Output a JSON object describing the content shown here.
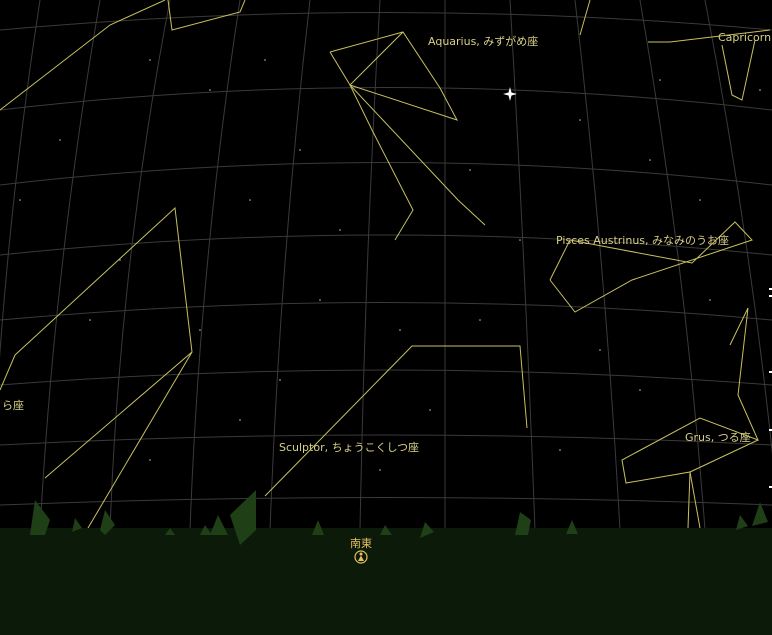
{
  "constellations": {
    "aquarius": "Aquarius, みずがめ座",
    "capricornus": "Capricorn",
    "piscis_austrinus": "Pisces Austrinus, みなみのうお座",
    "sculptor": "Sculptor, ちょうこくしつ座",
    "grus": "Grus, つる座",
    "left_partial": "ら座"
  },
  "horizon": {
    "direction_label": "南東"
  },
  "colors": {
    "sky": "#000000",
    "grid": "#3a3a3a",
    "constellation_line": "#c8c060",
    "label": "#d8cf8a",
    "ground": "#0b1a09",
    "tree": "#1f3f17",
    "compass": "#e8c060"
  },
  "icons": {
    "compass_marker": "person-marker-icon",
    "bright_star": "star-sparkle-icon"
  }
}
